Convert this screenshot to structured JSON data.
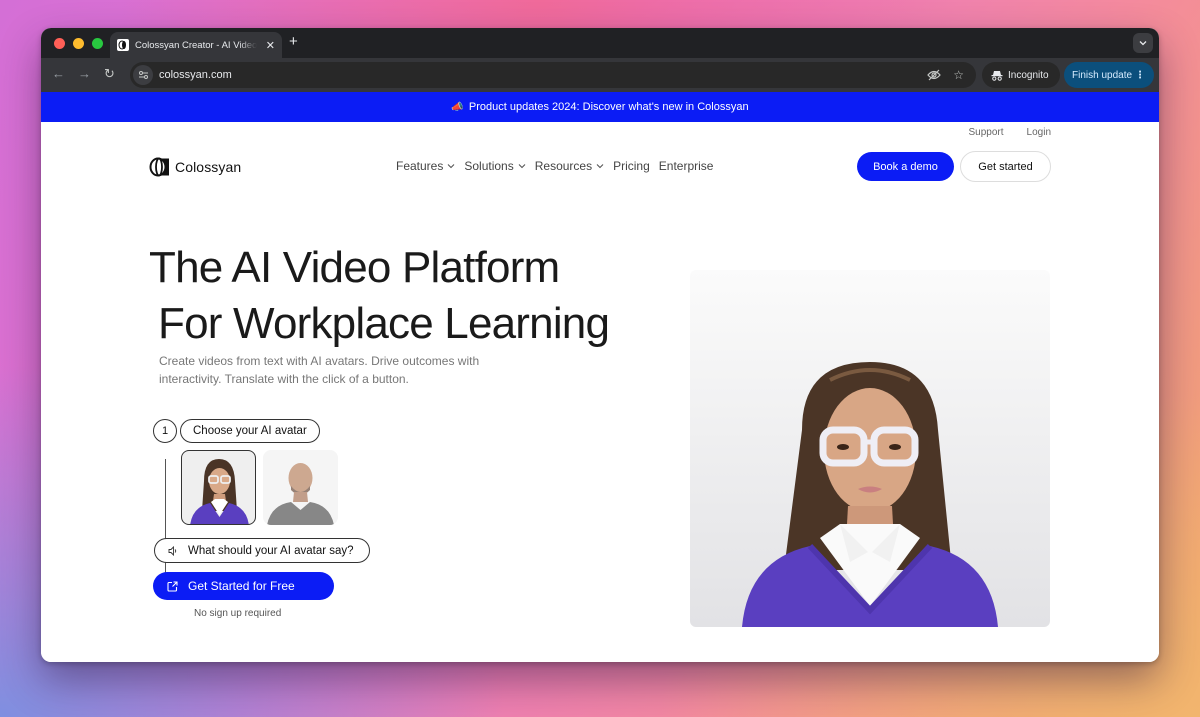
{
  "browser": {
    "tab": {
      "title": "Colossyan Creator - AI Video",
      "favicon": "colossyan-logo-icon"
    },
    "new_tab_label": "+",
    "url": "colossyan.com",
    "incognito_label": "Incognito",
    "finish_update_label": "Finish update",
    "icons": {
      "back": "←",
      "forward": "→",
      "reload": "↻",
      "close": "✕",
      "more": "⋮",
      "tab_menu": "⌄",
      "star": "☆"
    }
  },
  "banner": {
    "emoji": "📣",
    "text": "Product updates 2024: Discover what's new in Colossyan"
  },
  "header": {
    "utility_links": [
      {
        "label": "Support"
      },
      {
        "label": "Login"
      }
    ],
    "logo_text": "Colossyan",
    "nav": [
      {
        "label": "Features",
        "has_dropdown": true
      },
      {
        "label": "Solutions",
        "has_dropdown": true
      },
      {
        "label": "Resources",
        "has_dropdown": true
      },
      {
        "label": "Pricing",
        "has_dropdown": false
      },
      {
        "label": "Enterprise",
        "has_dropdown": false
      }
    ],
    "chevron": "⌄",
    "book_demo_label": "Book a demo",
    "get_started_label": "Get started"
  },
  "hero": {
    "title_line1": "The AI Video Platform",
    "title_line2": "For Workplace Learning",
    "subtitle": "Create videos from text with AI avatars. Drive outcomes with interactivity. Translate with the click of a button.",
    "step_number": "1",
    "step_label": "Choose your AI avatar",
    "avatars": [
      {
        "name": "female-avatar",
        "selected": true
      },
      {
        "name": "male-avatar",
        "selected": false
      }
    ],
    "say_prompt": "What should your AI avatar say?",
    "cta_label": "Get Started for Free",
    "cta_note": "No sign up required"
  },
  "colors": {
    "brand_blue": "#0b1cf5",
    "finish_update_bg": "#0b4f7c",
    "sweater_purple": "#5a3fc0"
  }
}
